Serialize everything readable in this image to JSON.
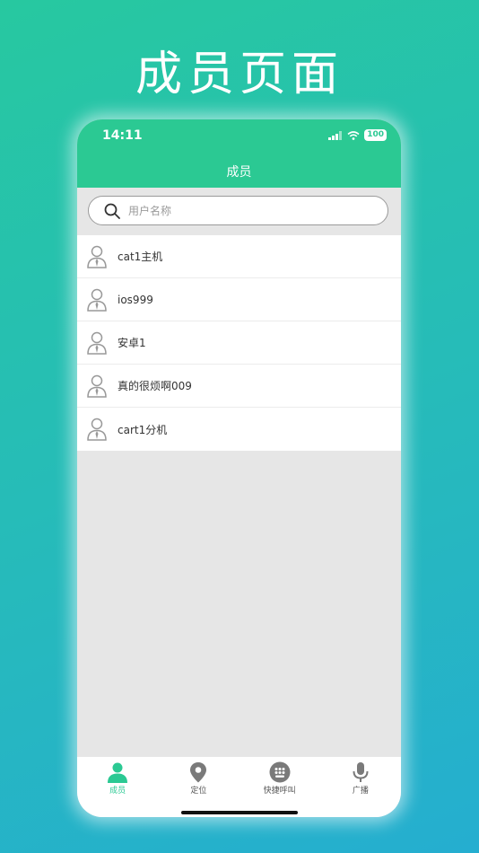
{
  "promo": {
    "title": "成员页面"
  },
  "status_bar": {
    "time": "14:11",
    "battery": "100"
  },
  "nav": {
    "title": "成员"
  },
  "search": {
    "placeholder": "用户名称",
    "value": ""
  },
  "members": [
    {
      "name": "cat1主机"
    },
    {
      "name": "ios999"
    },
    {
      "name": "安卓1"
    },
    {
      "name": "真的很烦啊009"
    },
    {
      "name": "cart1分机"
    }
  ],
  "tabs": [
    {
      "label": "成员",
      "icon": "person-icon",
      "active": true
    },
    {
      "label": "定位",
      "icon": "location-pin-icon",
      "active": false
    },
    {
      "label": "快捷呼叫",
      "icon": "keypad-icon",
      "active": false
    },
    {
      "label": "广播",
      "icon": "microphone-icon",
      "active": false
    }
  ],
  "colors": {
    "accent": "#2bc993",
    "background_gradient_start": "#27c8a0",
    "background_gradient_end": "#25aed0"
  }
}
